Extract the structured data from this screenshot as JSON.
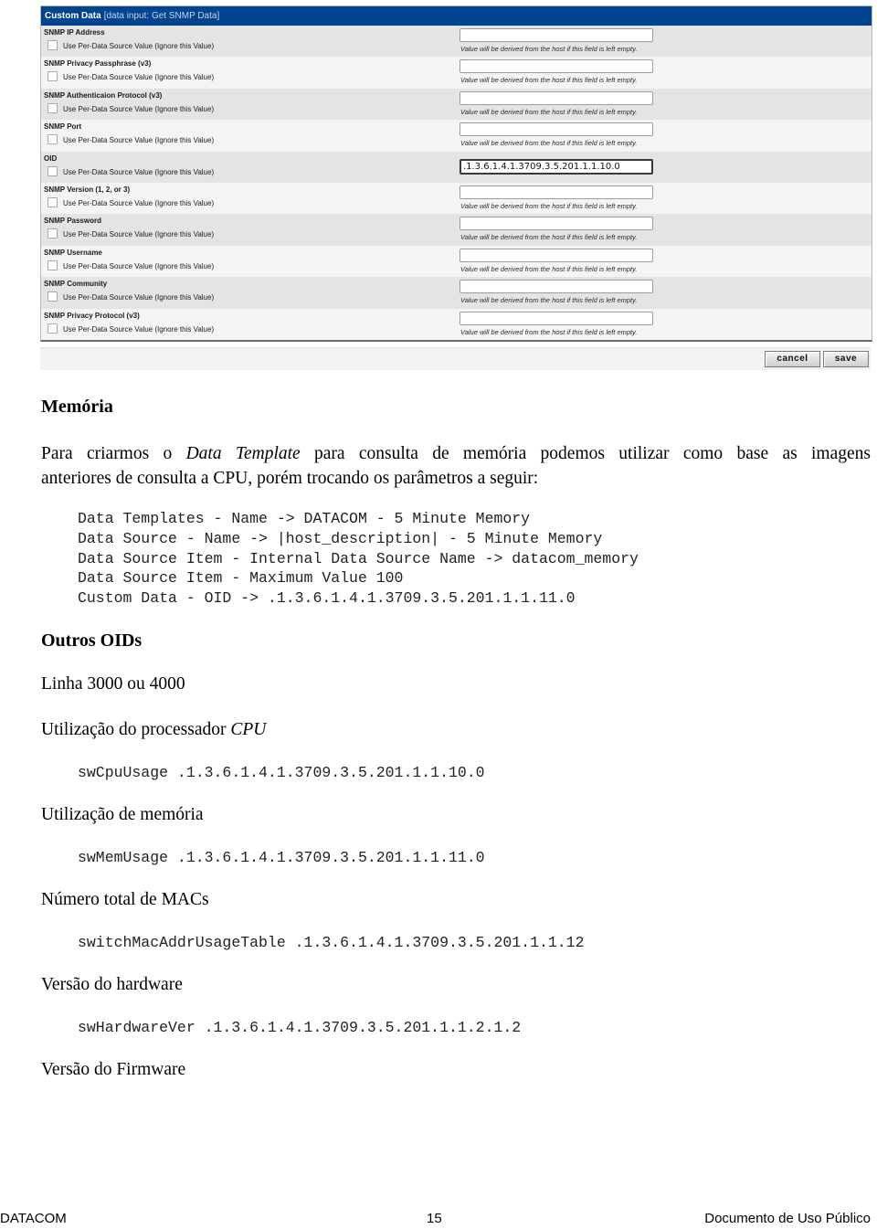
{
  "form": {
    "header_title": "Custom Data",
    "header_subtitle": "[data input: Get SNMP Data]",
    "checkbox_label": "Use Per-Data Source Value (Ignore this Value)",
    "hint_text": "Value will be derived from the host if this field is left empty.",
    "rows": [
      {
        "label": "SNMP IP Address",
        "value": "",
        "checked": false
      },
      {
        "label": "SNMP Privacy Passphrase (v3)",
        "value": "",
        "checked": false
      },
      {
        "label": "SNMP Authenticaion Protocol (v3)",
        "value": "",
        "checked": false
      },
      {
        "label": "SNMP Port",
        "value": "",
        "checked": false
      },
      {
        "label": "OID",
        "value": ".1.3.6.1.4.1.3709.3.5.201.1.1.10.0",
        "checked": false
      },
      {
        "label": "SNMP Version (1, 2, or 3)",
        "value": "",
        "checked": false
      },
      {
        "label": "SNMP Password",
        "value": "",
        "checked": false
      },
      {
        "label": "SNMP Username",
        "value": "",
        "checked": false
      },
      {
        "label": "SNMP Community",
        "value": "",
        "checked": false
      },
      {
        "label": "SNMP Privacy Protocol (v3)",
        "value": "",
        "checked": false
      }
    ],
    "cancel_label": "cancel",
    "save_label": "save",
    "header_color": "#00438e"
  },
  "doc": {
    "section_memoria": "Memória",
    "intro_part1": "Para criarmos o ",
    "intro_italic": "Data Template",
    "intro_part2": " para consulta de memória podemos utilizar como base as imagens",
    "intro_line2": "anteriores de consulta a CPU, porém trocando os parâmetros a seguir:",
    "params": [
      "Data Templates - Name -> DATACOM - 5 Minute Memory",
      "Data Source - Name -> |host_description| - 5 Minute Memory",
      "Data Source Item - Internal Data Source Name -> datacom_memory",
      "Data Source Item - Maximum Value 100",
      "Custom Data - OID -> .1.3.6.1.4.1.3709.3.5.201.1.1.11.0"
    ],
    "section_outros": "Outros OIDs",
    "linha": "Linha 3000 ou 4000",
    "cpu_title": "Utilização do processador ",
    "cpu_title_italic": "CPU",
    "cpu_oid": "swCpuUsage .1.3.6.1.4.1.3709.3.5.201.1.1.10.0",
    "mem_title": "Utilização de memória",
    "mem_oid": "swMemUsage .1.3.6.1.4.1.3709.3.5.201.1.1.11.0",
    "mac_title": "Número total de MACs",
    "mac_oid": "switchMacAddrUsageTable .1.3.6.1.4.1.3709.3.5.201.1.1.12",
    "hw_title": "Versão do hardware",
    "hw_oid": "swHardwareVer .1.3.6.1.4.1.3709.3.5.201.1.1.2.1.2",
    "fw_title": "Versão do Firmware"
  },
  "footer": {
    "company": "DATACOM",
    "page_number": "15",
    "classification": "Documento de Uso Público"
  }
}
